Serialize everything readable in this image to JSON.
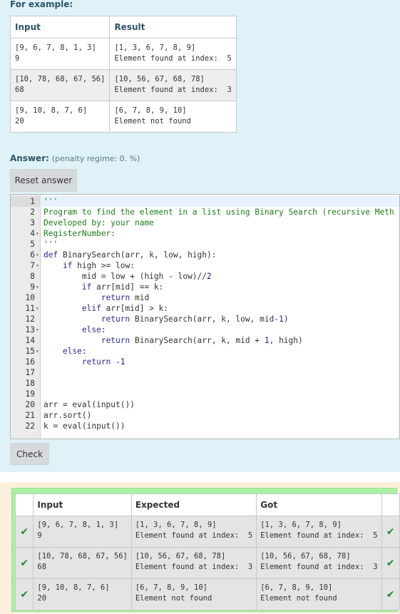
{
  "question": {
    "for_example_label": "For example:",
    "example_headers": [
      "Input",
      "Result"
    ],
    "examples": [
      {
        "input": [
          "[9, 6, 7, 8, 1, 3]",
          "9"
        ],
        "result": [
          "[1, 3, 6, 7, 8, 9]",
          "Element found at index:  5"
        ]
      },
      {
        "input": [
          "[10, 78, 68, 67, 56]",
          "68"
        ],
        "result": [
          "[10, 56, 67, 68, 78]",
          "Element found at index:  3"
        ]
      },
      {
        "input": [
          "[9, 10, 8, 7, 6]",
          "20"
        ],
        "result": [
          "[6, 7, 8, 9, 10]",
          "Element not found"
        ]
      }
    ],
    "answer_label": "Answer:",
    "penalty_text": "(penalty regime: 0. %)",
    "reset_button": "Reset answer",
    "check_button": "Check"
  },
  "editor": {
    "lines": [
      "'''",
      "Program to find the element in a list using Binary Search (recursive Meth",
      "Developed by: your name",
      "RegisterNumber:",
      "'''",
      "def BinarySearch(arr, k, low, high):",
      "    if high >= low:",
      "        mid = low + (high - low)//2",
      "        if arr[mid] == k:",
      "            return mid",
      "        elif arr[mid] > k:",
      "            return BinarySearch(arr, k, low, mid-1)",
      "        else:",
      "            return BinarySearch(arr, k, mid + 1, high)",
      "    else:",
      "        return -1",
      "",
      "",
      "",
      "arr = eval(input())",
      "arr.sort()",
      "k = eval(input())"
    ],
    "line_numbers": [
      "1",
      "2",
      "3",
      "4",
      "5",
      "6",
      "7",
      "8",
      "9",
      "10",
      "11",
      "12",
      "13",
      "14",
      "15",
      "16",
      "17",
      "18",
      "19",
      "20",
      "21",
      "22"
    ],
    "fold_markers": {
      "4": "▾",
      "6": "▾",
      "7": "▾",
      "9": "▾",
      "11": "▾",
      "13": "▾",
      "15": "▾"
    }
  },
  "results": {
    "headers": [
      "",
      "Input",
      "Expected",
      "Got",
      ""
    ],
    "rows": [
      {
        "input": [
          "[9, 6, 7, 8, 1, 3]",
          "9"
        ],
        "expected": [
          "[1, 3, 6, 7, 8, 9]",
          "Element found at index:  5"
        ],
        "got": [
          "[1, 3, 6, 7, 8, 9]",
          "Element found at index:  5"
        ]
      },
      {
        "input": [
          "[10, 78, 68, 67, 56]",
          "68"
        ],
        "expected": [
          "[10, 56, 67, 68, 78]",
          "Element found at index:  3"
        ],
        "got": [
          "[10, 56, 67, 68, 78]",
          "Element found at index:  3"
        ]
      },
      {
        "input": [
          "[9, 10, 8, 7, 6]",
          "20"
        ],
        "expected": [
          "[6, 7, 8, 9, 10]",
          "Element not found"
        ],
        "got": [
          "[6, 7, 8, 9, 10]",
          "Element not found"
        ]
      }
    ],
    "tick_icon": "check-icon",
    "pass_color": "#1a8c2e"
  }
}
